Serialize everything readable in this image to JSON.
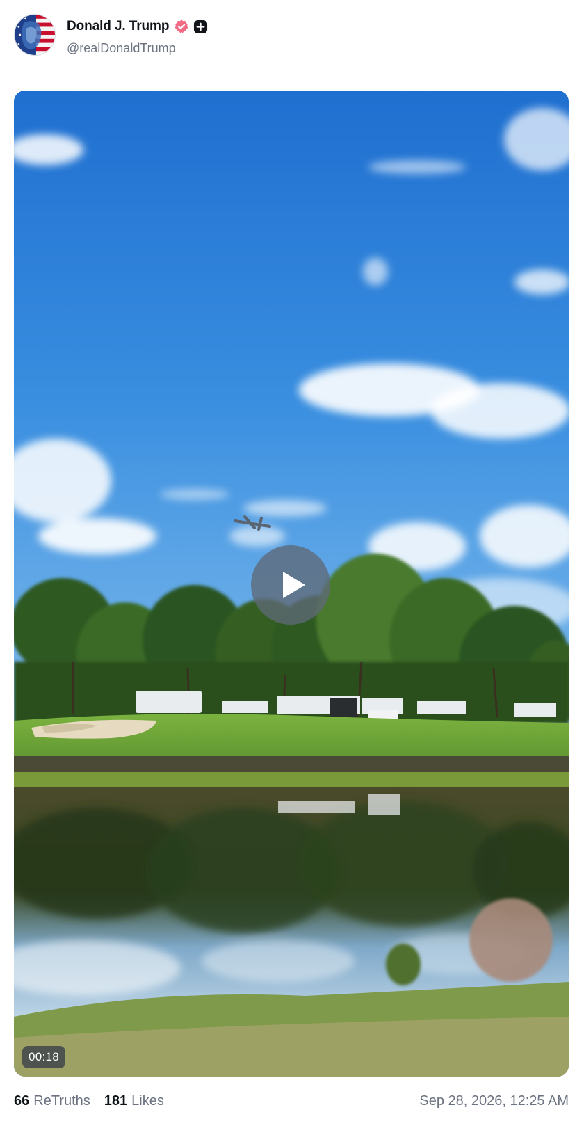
{
  "author": {
    "display_name": "Donald J. Trump",
    "handle": "@realDonaldTrump",
    "avatar_icon": "flag-portrait-avatar",
    "verified_icon": "verified-badge-icon",
    "plus_icon": "plus-badge-icon",
    "verified_color": "#f26b85"
  },
  "media": {
    "type": "video",
    "duration": "00:18",
    "play_icon": "play-icon",
    "scene": "golf-course-pond-airplane"
  },
  "engagement": {
    "retruths_count": "66",
    "retruths_label": "ReTruths",
    "likes_count": "181",
    "likes_label": "Likes"
  },
  "timestamp": "Sep 28, 2026, 12:25 AM",
  "colors": {
    "text_primary": "#0f1419",
    "text_secondary": "#6b7280",
    "sky": "#2f83d6",
    "grass": "#6da83a"
  }
}
